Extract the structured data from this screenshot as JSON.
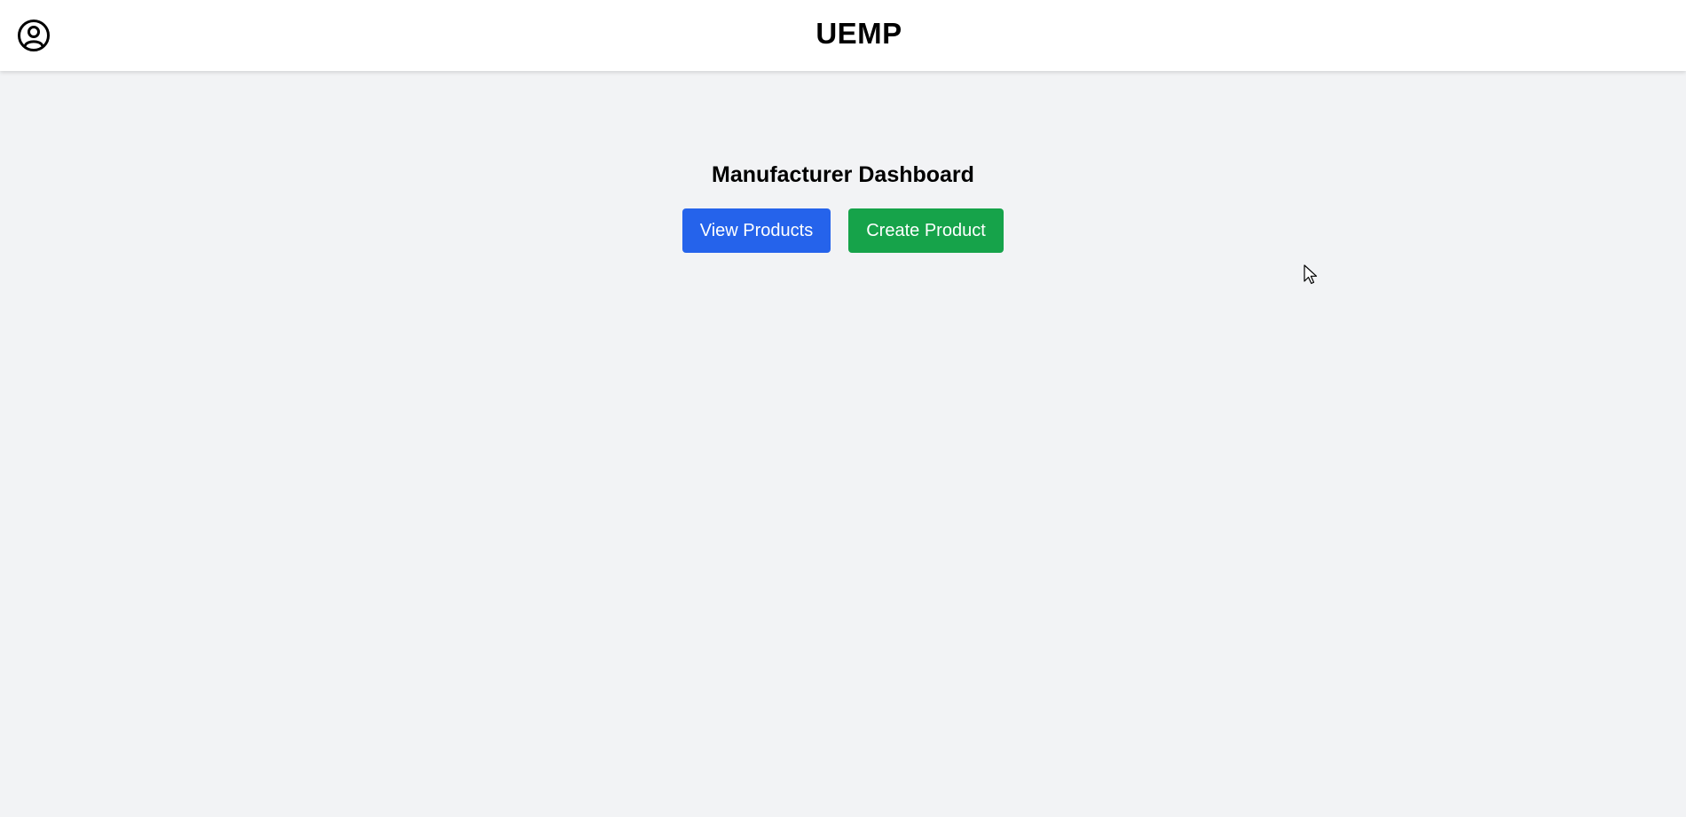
{
  "header": {
    "title": "UEMP",
    "profile_icon": "user-circle-icon"
  },
  "main": {
    "heading": "Manufacturer Dashboard",
    "buttons": {
      "view_products": "View Products",
      "create_product": "Create Product"
    }
  },
  "colors": {
    "background": "#f2f3f5",
    "header_bg": "#ffffff",
    "view_button": "#2563eb",
    "create_button": "#16a34a"
  }
}
